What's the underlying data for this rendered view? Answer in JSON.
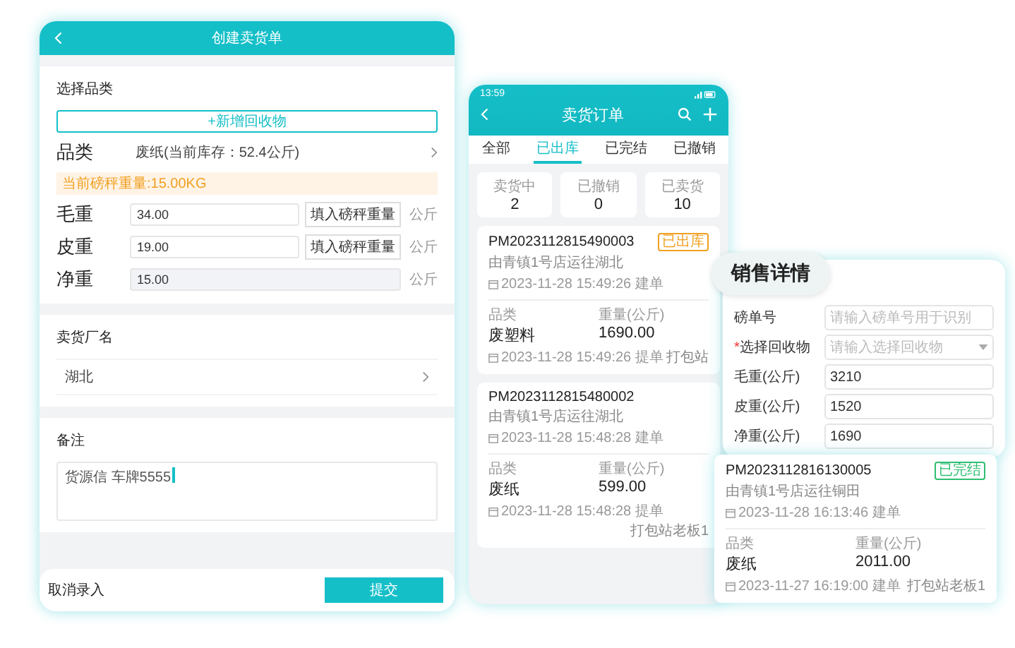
{
  "tablet": {
    "title": "创建卖货单",
    "category_section": {
      "heading": "选择品类",
      "add_button": "+新增回收物",
      "category": {
        "label": "品类",
        "value": "废纸(当前库存：52.4公斤)"
      },
      "scale_notice": "当前磅秤重量:15.00KG",
      "weights": [
        {
          "label": "毛重",
          "value": "34.00",
          "kind": "editable",
          "button": "填入磅秤重量",
          "unit": "公斤"
        },
        {
          "label": "皮重",
          "value": "19.00",
          "kind": "editable",
          "button": "填入磅秤重量",
          "unit": "公斤"
        },
        {
          "label": "净重",
          "value": "15.00",
          "kind": "computed",
          "unit": "公斤"
        }
      ]
    },
    "factory_section": {
      "heading": "卖货厂名",
      "value": "湖北"
    },
    "note_section": {
      "heading": "备注",
      "value": "货源信 车牌5555"
    },
    "footer": {
      "cancel": "取消录入",
      "submit": "提交"
    }
  },
  "phone": {
    "status_time": "13:59",
    "title": "卖货订单",
    "tabs": [
      {
        "label": "全部",
        "selected": false
      },
      {
        "label": "已出库",
        "selected": true
      },
      {
        "label": "已完结",
        "selected": false
      },
      {
        "label": "已撤销",
        "selected": false
      }
    ],
    "stats": [
      {
        "label": "卖货中",
        "value": "2"
      },
      {
        "label": "已撤销",
        "value": "0"
      },
      {
        "label": "已卖货",
        "value": "10"
      }
    ],
    "orders": [
      {
        "number": "PM2023112815490003",
        "route": "由青镇1号店运往湖北",
        "created": "2023-11-28 15:49:26 建单",
        "badge": {
          "label": "已出库",
          "color": "#f0a020"
        },
        "product_label": "品类",
        "weight_label": "重量(公斤)",
        "product": "废塑料",
        "weight": "1690.00",
        "footer_date": "2023-11-28 15:49:26 提单",
        "operator": "打包站"
      },
      {
        "number": "PM2023112815480002",
        "route": "由青镇1号店运往湖北",
        "created": "2023-11-28 15:48:28 建单",
        "product_label": "品类",
        "weight_label": "重量(公斤)",
        "product": "废纸",
        "weight": "599.00",
        "footer_date": "2023-11-28 15:48:28 提单",
        "operator": "打包站老板1"
      }
    ]
  },
  "sales_detail": {
    "title": "销售详情",
    "fields": [
      {
        "label": "磅单号",
        "kind": "text",
        "placeholder": "请输入磅单号用于识别"
      },
      {
        "label": "选择回收物",
        "marker": "*",
        "kind": "select",
        "placeholder": "请输入选择回收物"
      },
      {
        "label": "毛重(公斤)",
        "kind": "text",
        "value": "3210"
      },
      {
        "label": "皮重(公斤)",
        "kind": "text",
        "value": "1520"
      },
      {
        "label": "净重(公斤)",
        "kind": "text",
        "value": "1690"
      }
    ]
  },
  "order_card": {
    "number": "PM2023112816130005",
    "route": "由青镇1号店运往铜田",
    "created": "2023-11-28 16:13:46 建单",
    "badge": {
      "label": "已完结",
      "color": "#2fbf71"
    },
    "product_label": "品类",
    "weight_label": "重量(公斤)",
    "product": "废纸",
    "weight": "2011.00",
    "footer_date": "2023-11-27 16:19:00 建单",
    "operator": "打包站老板1"
  }
}
